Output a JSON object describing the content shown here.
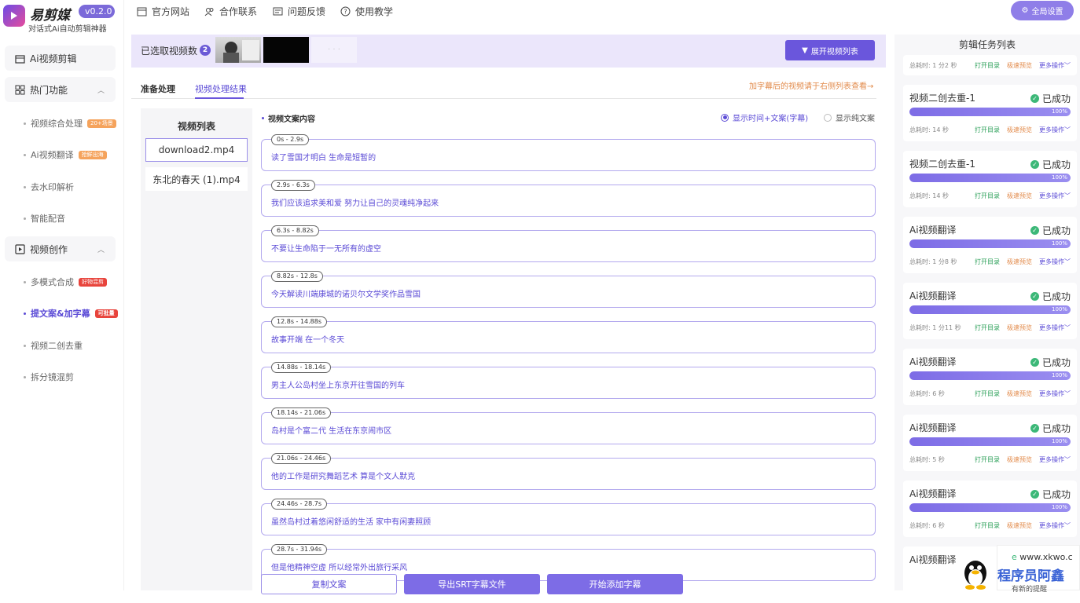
{
  "app": {
    "brand": "易剪媒",
    "version": "v0.2.0",
    "slogan": "对话式Ai自动剪辑神器"
  },
  "sidebar": {
    "groups": [
      {
        "label": "Ai视频剪辑",
        "icon": "film-icon"
      },
      {
        "label": "热门功能",
        "icon": "grid-icon"
      },
      {
        "label": "视频创作",
        "icon": "video-icon"
      }
    ],
    "hot_items": [
      {
        "label": "视频综合处理",
        "tag": "20+场景",
        "tag_color": "#f5a35c"
      },
      {
        "label": "Ai视频翻译",
        "tag": "抢鲜出海",
        "tag_color": "#f5a35c"
      },
      {
        "label": "去水印解析",
        "tag": ""
      },
      {
        "label": "智能配音",
        "tag": ""
      }
    ],
    "create_items": [
      {
        "label": "多模式合成",
        "tag": "好物混剪",
        "tag_color": "#e8443c"
      },
      {
        "label": "提文案&加字幕",
        "tag": "可批量",
        "tag_color": "#e8443c"
      },
      {
        "label": "视频二创去重",
        "tag": ""
      },
      {
        "label": "拆分镜混剪",
        "tag": ""
      }
    ]
  },
  "topbar": {
    "links": [
      "官方网站",
      "合作联系",
      "问题反馈",
      "使用教学"
    ],
    "global_settings": "全局设置"
  },
  "selection": {
    "label": "已选取视频数",
    "count": "2",
    "expand_button": "展开视频列表"
  },
  "tabs": {
    "prepare": "准备处理",
    "result": "视频处理结果",
    "hint": "加字幕后的视频请于右侧列表查看→"
  },
  "video_list": {
    "title": "视频列表",
    "items": [
      "download2.mp4",
      "东北的春天 (1).mp4"
    ]
  },
  "content": {
    "section_title": "视频文案内容",
    "radio_time_text": "显示时间+文案(字幕)",
    "radio_plain_text": "显示纯文案",
    "segments": [
      {
        "time": "0s - 2.9s",
        "text": "读了雪国才明白 生命是短暂的"
      },
      {
        "time": "2.9s - 6.3s",
        "text": "我们应该追求美和爱 努力让自己的灵魂纯净起来"
      },
      {
        "time": "6.3s - 8.82s",
        "text": "不要让生命陷于一无所有的虚空"
      },
      {
        "time": "8.82s - 12.8s",
        "text": "今天解读川端康城的诺贝尔文学奖作品雪国"
      },
      {
        "time": "12.8s - 14.88s",
        "text": "故事开端 在一个冬天"
      },
      {
        "time": "14.88s - 18.14s",
        "text": "男主人公岛村坐上东京开往雪国的列车"
      },
      {
        "time": "18.14s - 21.06s",
        "text": "岛村是个富二代 生活在东京闹市区"
      },
      {
        "time": "21.06s - 24.46s",
        "text": "他的工作是研究舞蹈艺术 算是个文人默克"
      },
      {
        "time": "24.46s - 28.7s",
        "text": "虽然岛村过着悠闲舒适的生活 家中有闲妻照顾"
      },
      {
        "time": "28.7s - 31.94s",
        "text": "但是他精神空虚 所以经常外出旅行采风"
      }
    ],
    "buttons": {
      "copy": "复制文案",
      "export": "导出SRT字幕文件",
      "add": "开始添加字幕"
    }
  },
  "tasks": {
    "title": "剪辑任务列表",
    "first_meta": "总耗时: 1 分2 秒",
    "actions": {
      "open": "打开目录",
      "preview": "极速预览",
      "more": "更多操作"
    },
    "status": "已成功",
    "percent_label": "100%",
    "items": [
      {
        "name": "视频二创去重-1",
        "progress": 1.0,
        "duration": "总耗时: 14 秒"
      },
      {
        "name": "视频二创去重-1",
        "progress": 1.0,
        "duration": "总耗时: 14 秒"
      },
      {
        "name": "Ai视频翻译",
        "progress": 1.0,
        "duration": "总耗时: 1 分8 秒"
      },
      {
        "name": "Ai视频翻译",
        "progress": 1.0,
        "duration": "总耗时: 1 分11 秒"
      },
      {
        "name": "Ai视频翻译",
        "progress": 1.0,
        "duration": "总耗时: 6 秒"
      },
      {
        "name": "Ai视频翻译",
        "progress": 1.0,
        "duration": "总耗时: 5 秒"
      },
      {
        "name": "Ai视频翻译",
        "progress": 1.0,
        "duration": "总耗时: 6 秒"
      },
      {
        "name": "Ai视频翻译",
        "progress": null,
        "duration": ""
      }
    ]
  },
  "overlay": {
    "site": "www.xkwo.c",
    "name": "程序员阿鑫",
    "line2": "有新的提醒"
  },
  "colors": {
    "accent": "#6a56dc",
    "success": "#3cb878",
    "warning": "#e28a4a"
  }
}
